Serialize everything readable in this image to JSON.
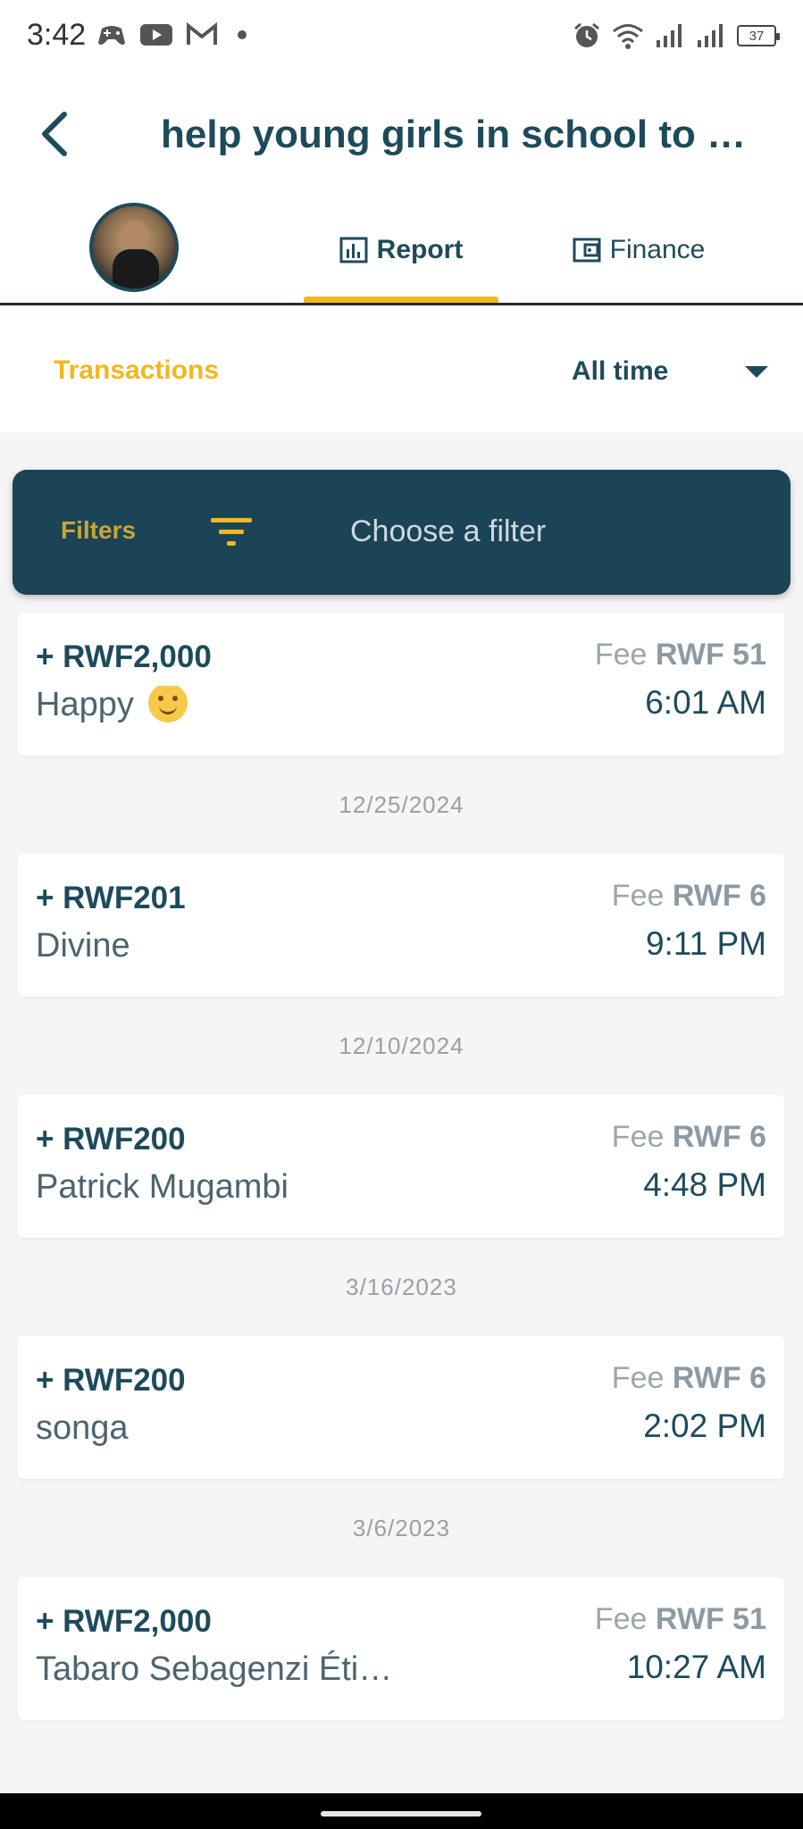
{
  "status_bar": {
    "time": "3:42",
    "battery": "37"
  },
  "header": {
    "title": "help young girls in school to g…"
  },
  "tabs": [
    {
      "label": "Report",
      "active": true,
      "icon": "bar-chart-icon"
    },
    {
      "label": "Finance",
      "active": false,
      "icon": "wallet-icon"
    }
  ],
  "subheader": {
    "section_label": "Transactions",
    "period_value": "All time"
  },
  "filters": {
    "label": "Filters",
    "placeholder": "Choose a filter"
  },
  "transactions": [
    {
      "amount": "+ RWF2,000",
      "donor": "Happy",
      "emoji": "smiling-face",
      "fee_label": "Fee",
      "fee_value": "RWF 51",
      "time": "6:01 AM"
    },
    {
      "amount": "+ RWF201",
      "donor": "Divine",
      "fee_label": "Fee",
      "fee_value": "RWF 6",
      "time": "9:11 PM"
    },
    {
      "amount": "+ RWF200",
      "donor": "Patrick Mugambi",
      "fee_label": "Fee",
      "fee_value": "RWF 6",
      "time": "4:48 PM"
    },
    {
      "amount": "+ RWF200",
      "donor": "songa",
      "fee_label": "Fee",
      "fee_value": "RWF 6",
      "time": "2:02 PM"
    },
    {
      "amount": "+ RWF2,000",
      "donor": "Tabaro Sebagenzi Éti…",
      "fee_label": "Fee",
      "fee_value": "RWF 51",
      "time": "10:27 AM"
    }
  ],
  "date_separators": [
    "12/25/2024",
    "12/10/2024",
    "3/16/2023",
    "3/6/2023"
  ],
  "colors": {
    "primary": "#1d4b5c",
    "accent": "#f2b71d",
    "filter_bar": "#1b4456",
    "background": "#f5f5f6"
  }
}
